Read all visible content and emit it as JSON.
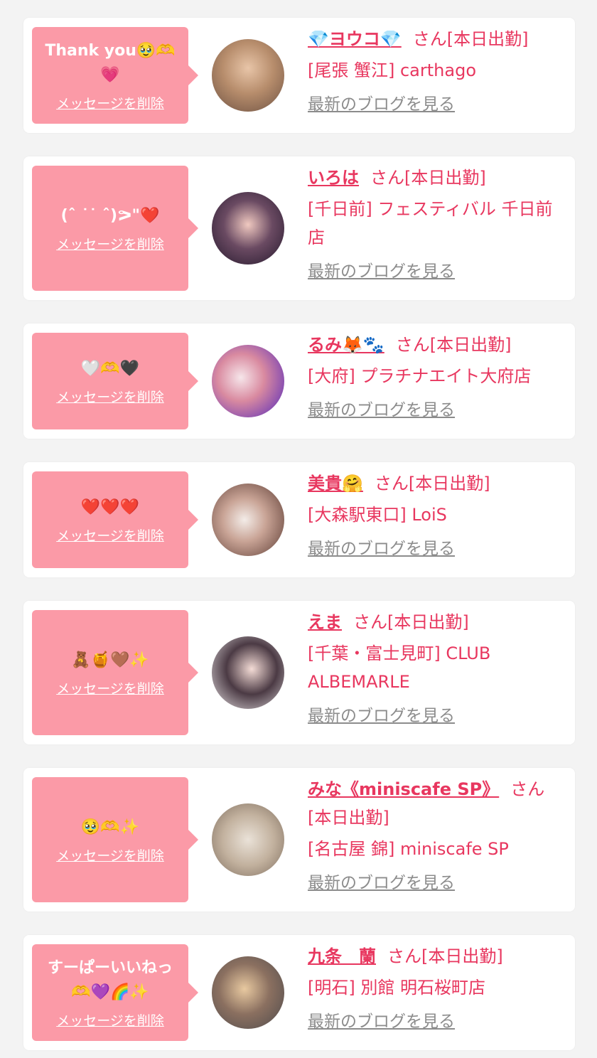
{
  "delete_label": "メッセージを削除",
  "blog_label": "最新のブログを見る",
  "colors": {
    "accent": "#e8375f",
    "bubble": "#fb9aa7",
    "link_gray": "#8c8c8c",
    "background": "#f3f3f3"
  },
  "items": [
    {
      "message": "Thank you🥹🫶💗",
      "name": "💎ヨウコ💎",
      "suffix": "さん[本日出勤]",
      "shop": "[尾張 蟹江] carthago"
    },
    {
      "message": "(ˆ ˙˙ ˆ)ᕗ\"❤️",
      "name": "いろは",
      "suffix": "さん[本日出勤]",
      "shop": "[千日前] フェスティバル 千日前店"
    },
    {
      "message": "🤍🫶🖤",
      "name": "るみ🦊🐾",
      "suffix": "さん[本日出勤]",
      "shop": "[大府] プラチナエイト大府店"
    },
    {
      "message": "❤️❤️❤️",
      "name": "美貴🤗",
      "suffix": "さん[本日出勤]",
      "shop": "[大森駅東口] LoiS"
    },
    {
      "message": "🧸🍯🤎✨",
      "name": "えま",
      "suffix": "さん[本日出勤]",
      "shop": "[千葉・富士見町] CLUB ALBEMARLE"
    },
    {
      "message": "🥹🫶✨",
      "name": "みな《miniscafe SP》",
      "suffix": "さん[本日出勤]",
      "shop": "[名古屋 錦] miniscafe SP"
    },
    {
      "message": "すーぱーいいねっ🫶💜🌈✨",
      "name": "九条　蘭",
      "suffix": "さん[本日出勤]",
      "shop": "[明石] 別館 明石桜町店"
    }
  ]
}
